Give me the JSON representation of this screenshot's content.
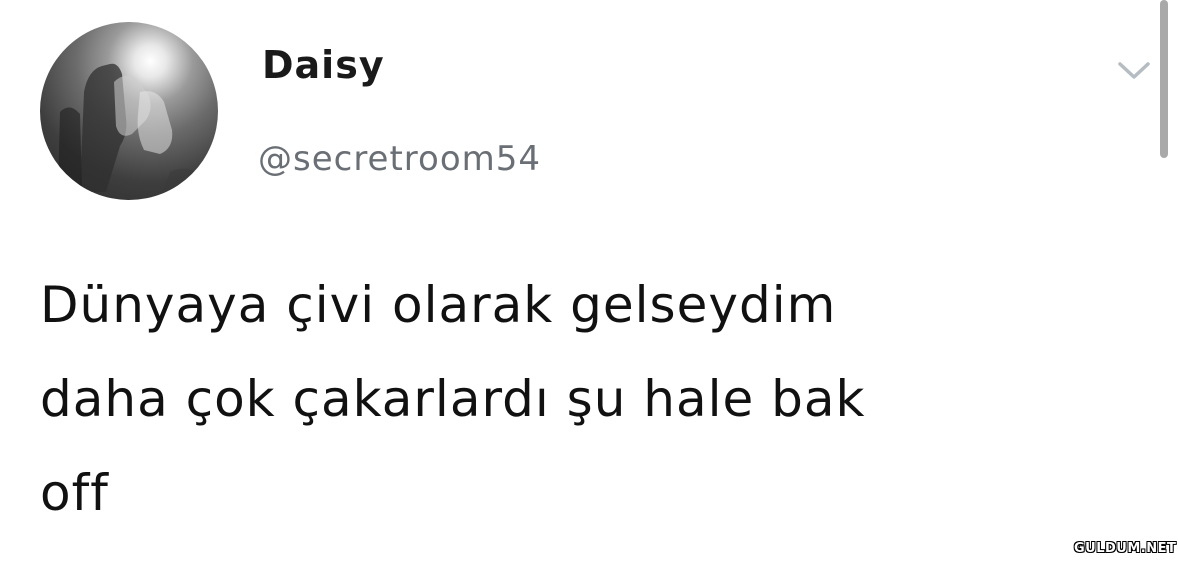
{
  "tweet": {
    "author": {
      "display_name": "Daisy",
      "handle": "@secretroom54",
      "avatar_icon": "profile-photo-grayscale"
    },
    "menu_icon": "chevron-down-icon",
    "text": "Dünyaya çivi olarak gelseydim\ndaha çok çakarlardı şu hale bak\noff"
  },
  "watermark": "GULDUM.NET",
  "colors": {
    "background": "#ffffff",
    "name_text": "#1a1a1a",
    "handle_text": "#6a6f75",
    "body_text": "#111111",
    "chevron": "#b5bcc2",
    "scrollbar": "#a9a9a9"
  }
}
